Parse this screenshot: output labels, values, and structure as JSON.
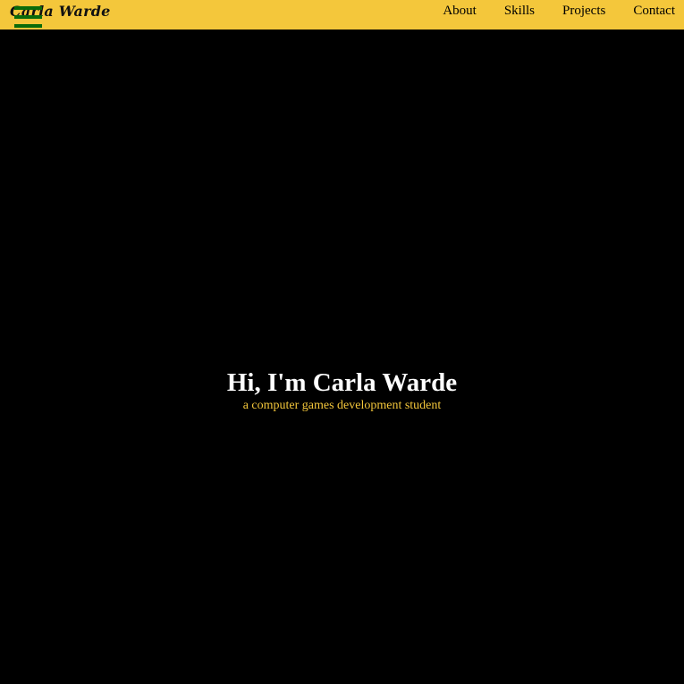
{
  "header": {
    "brand": "Carla Warde",
    "menu_icon": "hamburger-menu-icon",
    "nav": [
      {
        "label": "About"
      },
      {
        "label": "Skills"
      },
      {
        "label": "Projects"
      },
      {
        "label": "Contact"
      }
    ]
  },
  "hero": {
    "title": "Hi, I'm Carla Warde",
    "subtitle": "a computer games development student"
  },
  "colors": {
    "navbar_background": "#f4c73b",
    "page_background": "#000000",
    "menu_icon": "#0a6b0a",
    "title_text": "#ffffff",
    "subtitle_text": "#f4c73b"
  }
}
